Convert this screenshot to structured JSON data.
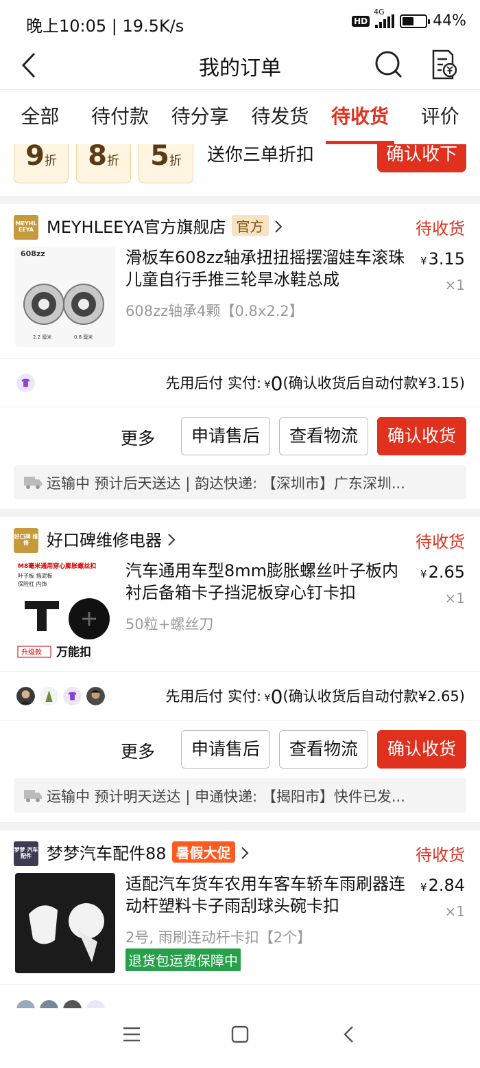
{
  "status_bar": {
    "time": "晚上10:05 | 19.5K/s",
    "hd": "HD",
    "network": "4G",
    "battery": "44%",
    "battery_level": 0.44
  },
  "nav": {
    "title": "我的订单"
  },
  "tabs": [
    {
      "label": "全部"
    },
    {
      "label": "待付款"
    },
    {
      "label": "待分享"
    },
    {
      "label": "待发货"
    },
    {
      "label": "待收货",
      "active": true
    },
    {
      "label": "评价"
    }
  ],
  "promo": {
    "coupons": [
      {
        "num": "9",
        "unit": "折"
      },
      {
        "num": "8",
        "unit": "折"
      },
      {
        "num": "5",
        "unit": "折"
      }
    ],
    "text": "送你三单折扣",
    "button": "确认收下"
  },
  "orders": [
    {
      "shop_logo": "MEYHL EEYA",
      "shop_name": "MEYHLEEYA官方旗舰店",
      "shop_tag": "官方",
      "status": "待收货",
      "title": "滑板车608zz轴承扭扭摇摆溜娃车滚珠儿童自行手推三轮旱冰鞋总成",
      "spec": "608zz轴承4颗【0.8x2.2】",
      "price_symbol": "¥",
      "price": "3.15",
      "qty": "×1",
      "pay_label": "先用后付 实付:",
      "pay_amount": "0",
      "pay_note": "(确认收货后自动付款¥3.15)",
      "more": "更多",
      "btn_after": "申请售后",
      "btn_track": "查看物流",
      "btn_confirm": "确认收货",
      "logistics": "运输中 预计后天送达 | 韵达快递: 【深圳市】广东深圳..."
    },
    {
      "shop_logo": "好口碑 维修",
      "shop_name": "好口碑维修电器",
      "status": "待收货",
      "title": "汽车通用车型8mm膨胀螺丝叶子板内衬后备箱卡子挡泥板穿心钉卡扣",
      "spec": "50粒+螺丝刀",
      "price_symbol": "¥",
      "price": "2.65",
      "qty": "×1",
      "pay_label": "先用后付 实付:",
      "pay_amount": "0",
      "pay_note": "(确认收货后自动付款¥2.65)",
      "more": "更多",
      "btn_after": "申请售后",
      "btn_track": "查看物流",
      "btn_confirm": "确认收货",
      "logistics": "运输中 预计明天送达 | 申通快递: 【揭阳市】快件已发..."
    },
    {
      "shop_logo": "梦梦 汽车配件",
      "shop_name": "梦梦汽车配件88",
      "shop_tag": "暑假大促",
      "status": "待收货",
      "title": "适配汽车货车农用车客车轿车雨刷器连动杆塑料卡子雨刮球头碗卡扣",
      "spec": "2号, 雨刷连动杆卡扣【2个】",
      "guarantee": "退货包运费保障中",
      "price_symbol": "¥",
      "price": "2.84",
      "qty": "×1"
    }
  ],
  "thumb_texts": {
    "t1_a": "608zz",
    "t1_b": "2.2 厘米",
    "t1_c": "0.8 厘米",
    "t2_a": "M8毫米通用穿心膨胀螺丝扣",
    "t2_b": "叶子板 挡泥板",
    "t2_c": "保险杠 内饰",
    "t2_d": "升级款",
    "t2_e": "万能扣"
  },
  "icons": [
    "back-icon",
    "search-icon",
    "bill-icon",
    "chevron-right-icon",
    "truck-icon",
    "menu-icon",
    "home-icon",
    "back-arrow-icon"
  ],
  "colors": {
    "accent": "#e0301e",
    "coupon_bg": "#fff5e1",
    "guarantee": "#26a04a"
  }
}
